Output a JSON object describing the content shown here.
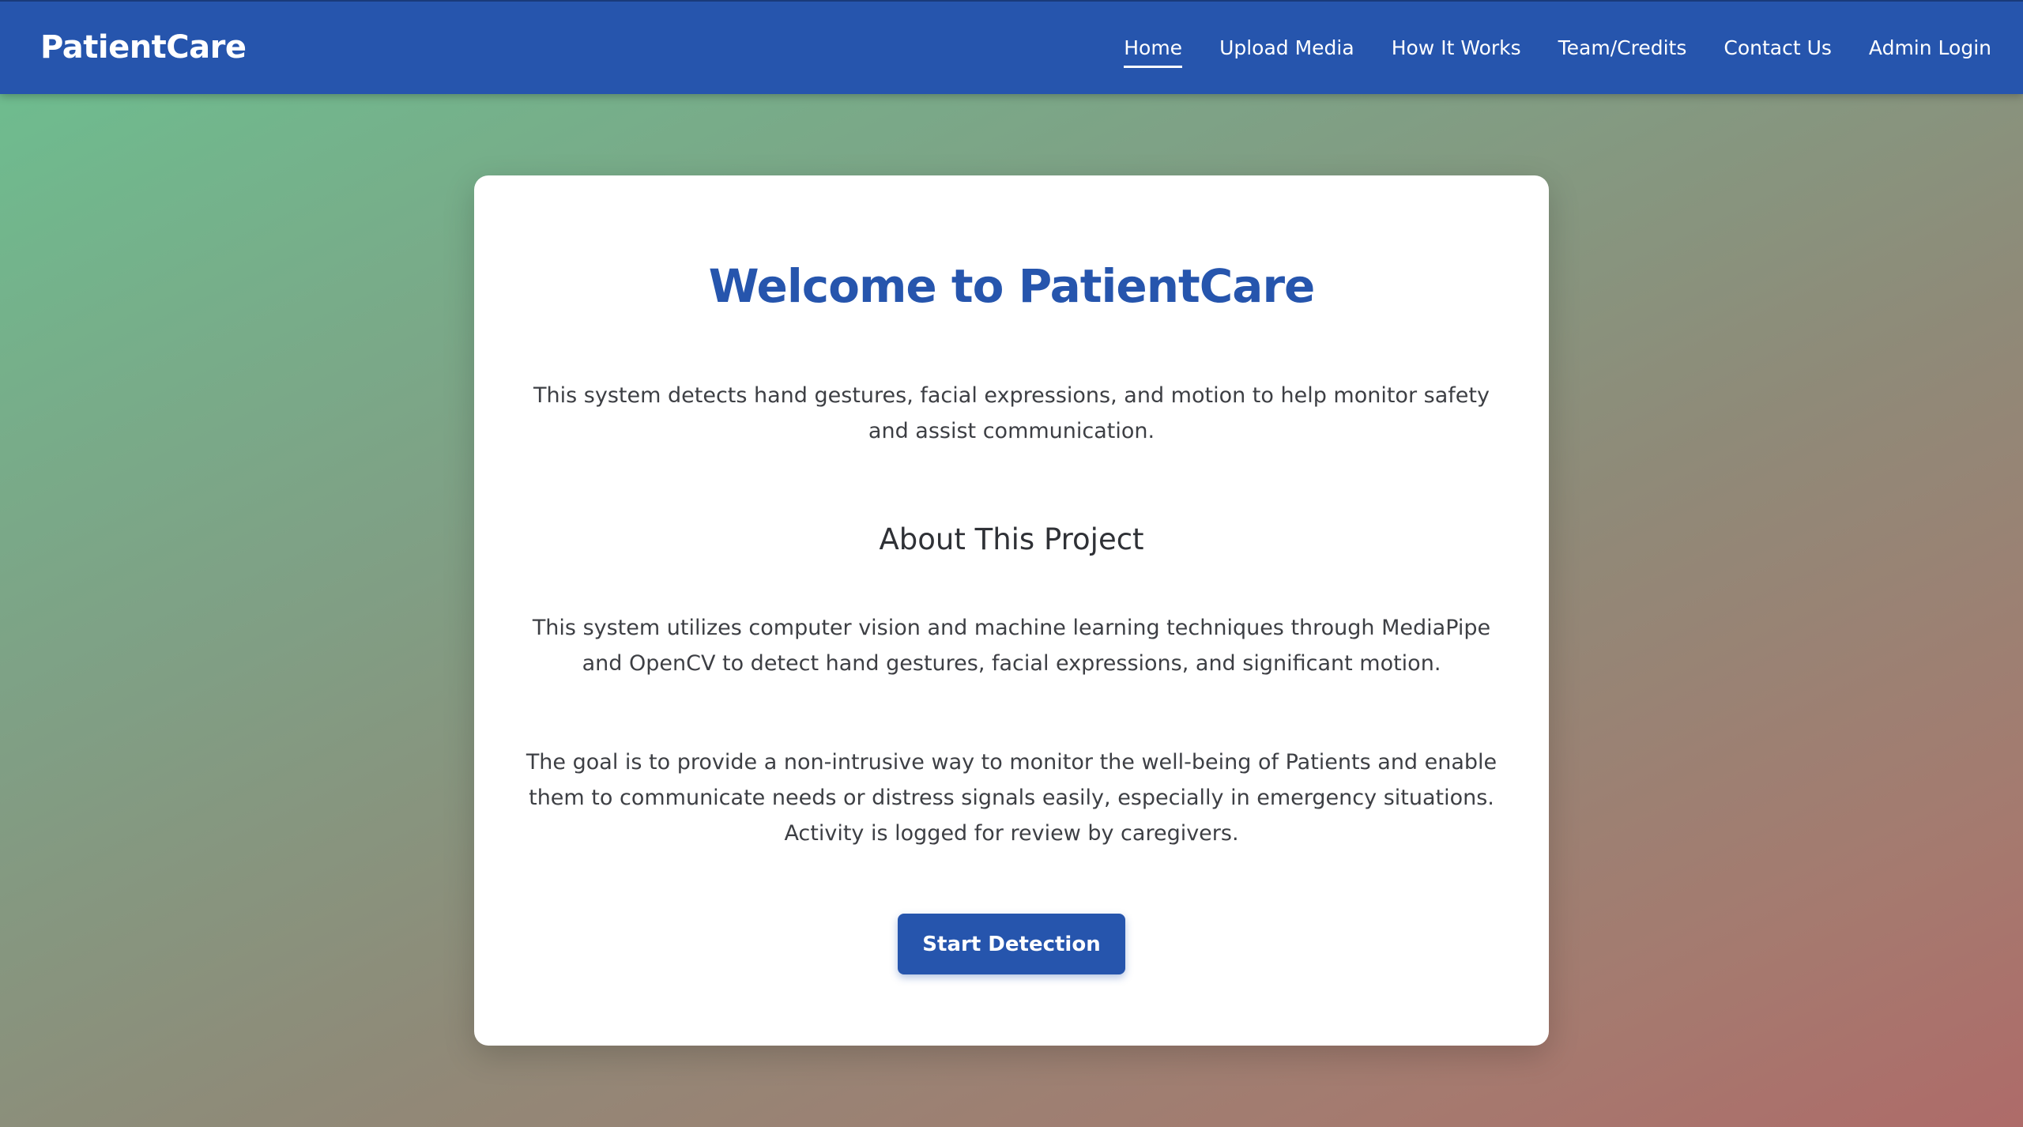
{
  "nav": {
    "brand": "PatientCare",
    "links": [
      {
        "label": "Home",
        "active": true
      },
      {
        "label": "Upload Media",
        "active": false
      },
      {
        "label": "How It Works",
        "active": false
      },
      {
        "label": "Team/Credits",
        "active": false
      },
      {
        "label": "Contact Us",
        "active": false
      },
      {
        "label": "Admin Login",
        "active": false
      }
    ]
  },
  "main": {
    "title": "Welcome to PatientCare",
    "intro": "This system detects hand gestures, facial expressions, and motion to help monitor safety and assist communication.",
    "about_heading": "About This Project",
    "about_paragraphs": [
      "This system utilizes computer vision and machine learning techniques through MediaPipe and OpenCV to detect hand gestures, facial expressions, and significant motion.",
      "The goal is to provide a non-intrusive way to monitor the well-being of Patients and enable them to communicate needs or distress signals easily, especially in emergency situations. Activity is logged for review by caregivers."
    ],
    "cta_label": "Start Detection"
  },
  "colors": {
    "primary": "#2655ad",
    "text": "#3d3f44",
    "card_bg": "#ffffff"
  }
}
